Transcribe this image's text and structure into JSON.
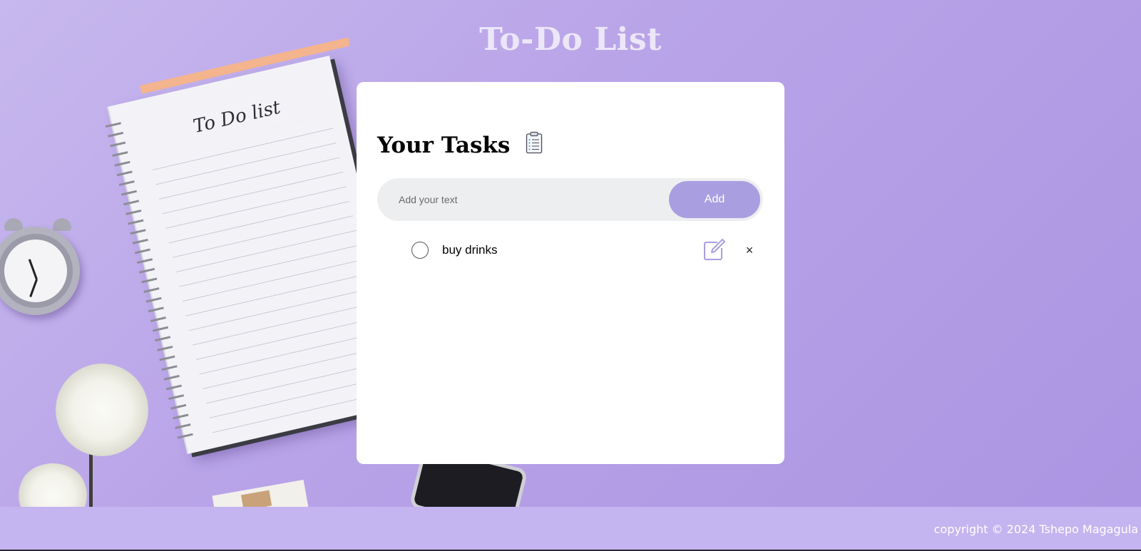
{
  "header": {
    "title": "To-Do List"
  },
  "card": {
    "heading": "Your Tasks",
    "heading_icon": "clipboard-icon",
    "input": {
      "placeholder": "Add your text",
      "value": ""
    },
    "add_label": "Add"
  },
  "tasks": [
    {
      "text": "buy drinks",
      "checked": false,
      "edit_icon": "edit-icon",
      "delete_label": "×"
    }
  ],
  "footer": {
    "text": "copyright © 2024 Tshepo Magagula"
  },
  "background": {
    "notebook_title": "To Do list",
    "scene": "notebook, alarm clock, white flowers, phone"
  },
  "colors": {
    "accent": "#a99ee0",
    "background": "#b9a4e8",
    "footer": "#c4b4ef",
    "title": "#ece6f9"
  }
}
